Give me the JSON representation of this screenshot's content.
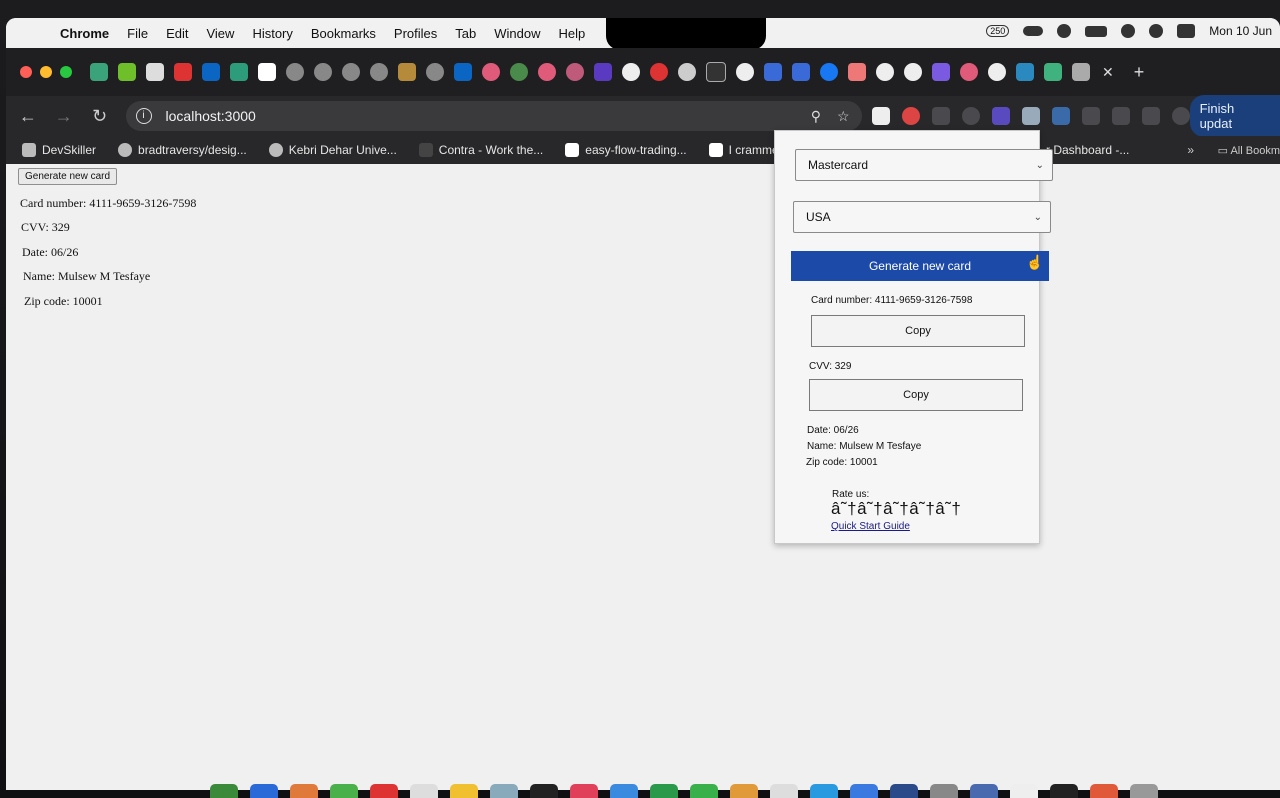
{
  "menubar": {
    "app": "Chrome",
    "items": [
      "File",
      "Edit",
      "View",
      "History",
      "Bookmarks",
      "Profiles",
      "Tab",
      "Window",
      "Help"
    ],
    "clock": "Mon 10 Jun",
    "badge_count": "250"
  },
  "tabstrip": {
    "close_glyph": "✕",
    "new_glyph": "+"
  },
  "toolbar": {
    "url": "localhost:3000",
    "finish_label": "Finish updat"
  },
  "bookmarks": {
    "items": [
      "DevSkiller",
      "bradtraversy/desig...",
      "Kebri Dehar Unive...",
      "Contra - Work the...",
      "easy-flow-trading...",
      "I crammed for a jo..."
    ],
    "partial": "r Dashboard -...",
    "more": "»",
    "all_label": "All Bookm"
  },
  "page": {
    "button_label": "Generate new card",
    "card_number": "Card number: 4111-9659-3126-7598",
    "cvv": "CVV: 329",
    "date": "Date: 06/26",
    "name": "Name: Mulsew M Tesfaye",
    "zip": "Zip code: 10001"
  },
  "popup": {
    "card_type_select": "Mastercard",
    "country_select": "USA",
    "generate_label": "Generate new card",
    "card_number": "Card number: 4111-9659-3126-7598",
    "copy_label_1": "Copy",
    "cvv": "CVV: 329",
    "copy_label_2": "Copy",
    "date": "Date: 06/26",
    "name": "Name: Mulsew M Tesfaye",
    "zip": "Zip code: 10001",
    "rate_label": "Rate us:",
    "stars": "â˜†â˜†â˜†â˜†â˜†",
    "guide_link": "Quick Start Guide"
  },
  "colors": {
    "accent_button": "#1c4aa8",
    "browser_chrome": "#28282a",
    "page_bg": "#f0f0f0"
  }
}
